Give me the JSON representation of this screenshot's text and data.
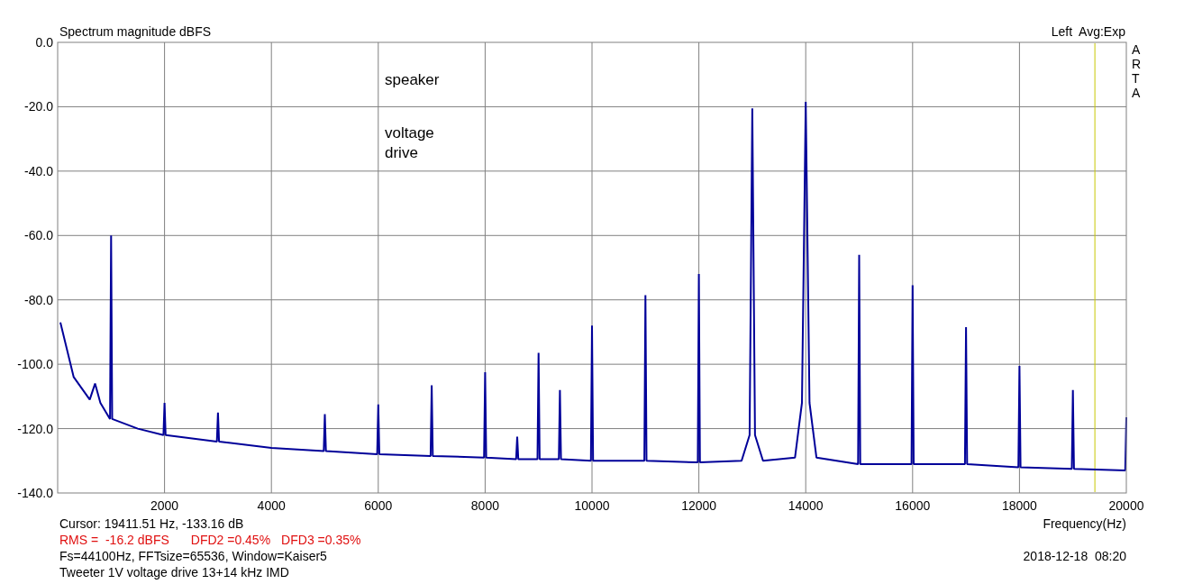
{
  "header": {
    "averaging": "Avg:Exp",
    "brand": "ARTA"
  },
  "plot": {
    "chart_data": {
      "type": "line",
      "title": "Spectrum magnitude dBFS",
      "xlabel": "Frequency(Hz)",
      "xlim": [
        0,
        20000
      ],
      "ylim": [
        -140,
        0
      ],
      "grid": true,
      "xticks": [
        2000,
        4000,
        6000,
        8000,
        10000,
        12000,
        14000,
        16000,
        18000,
        20000
      ],
      "yticks": [
        {
          "value": 0,
          "label": "0.0"
        },
        {
          "value": -20,
          "label": "-20.0"
        },
        {
          "value": -40,
          "label": "-40.0"
        },
        {
          "value": -60,
          "label": "-60.0"
        },
        {
          "value": -80,
          "label": "-80.0"
        },
        {
          "value": -100,
          "label": "-100.0"
        },
        {
          "value": -120,
          "label": "-120.0"
        },
        {
          "value": -140,
          "label": "-140.0"
        }
      ],
      "x": [
        50,
        300,
        600,
        700,
        800,
        980,
        1000,
        1020,
        1500,
        1980,
        2000,
        2020,
        2980,
        3000,
        3020,
        4000,
        4980,
        5000,
        5020,
        5980,
        6000,
        6020,
        6980,
        7000,
        7020,
        7980,
        8000,
        8020,
        8580,
        8600,
        8620,
        8980,
        9000,
        9020,
        9380,
        9400,
        9420,
        9980,
        10000,
        10020,
        10980,
        11000,
        11020,
        11980,
        12000,
        12020,
        12800,
        12950,
        13000,
        13050,
        13200,
        13800,
        13930,
        14000,
        14070,
        14200,
        14980,
        15000,
        15020,
        15980,
        16000,
        16020,
        16980,
        17000,
        17020,
        17980,
        18000,
        18020,
        18980,
        19000,
        19020,
        19980,
        20000
      ],
      "series": [
        {
          "name": "Left",
          "color": "#000099",
          "values": [
            -87,
            -104,
            -111,
            -106,
            -112,
            -117,
            -60,
            -117,
            -120,
            -122,
            -112,
            -122,
            -124,
            -115,
            -124,
            -126,
            -127,
            -115.5,
            -127,
            -128,
            -112.5,
            -128,
            -128.5,
            -106.5,
            -128.5,
            -129,
            -102.5,
            -129,
            -129.5,
            -122.5,
            -129.5,
            -129.5,
            -96.5,
            -129.5,
            -129.5,
            -108,
            -129.5,
            -130,
            -88,
            -130,
            -130,
            -78.5,
            -130,
            -130.5,
            -72,
            -130.5,
            -130,
            -122,
            -20.5,
            -122,
            -130,
            -129,
            -112,
            -18.5,
            -112,
            -129,
            -131,
            -66,
            -131,
            -131,
            -75.5,
            -131,
            -131,
            -88.5,
            -131,
            -132,
            -100.5,
            -132,
            -132.5,
            -108,
            -132.5,
            -133,
            -116.5
          ]
        }
      ],
      "annotations": [
        "speaker",
        "voltage drive"
      ],
      "ref_lines": [
        {
          "axis": "x",
          "value": 19411.51,
          "color": "#c8c800"
        }
      ]
    }
  },
  "footer": {
    "cursor": "Cursor: 19411.51 Hz, -133.16 dB",
    "measurements": [
      "RMS =  -16.2 dBFS",
      "DFD2 =0.45%",
      "DFD3 =0.35%"
    ],
    "settings": "Fs=44100Hz, FFTsize=65536, Window=Kaiser5",
    "description": "Tweeter 1V voltage drive 13+14 kHz IMD",
    "timestamp": "2018-12-18  08:20"
  }
}
